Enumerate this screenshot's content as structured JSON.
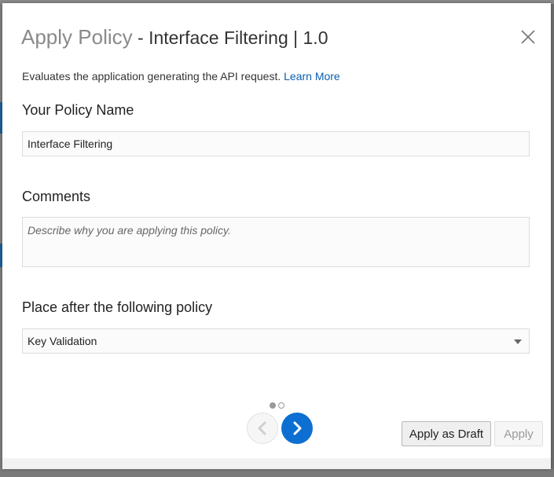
{
  "dialog": {
    "title_main": "Apply Policy",
    "title_sub": " - Interface Filtering | 1.0",
    "description": "Evaluates the application generating the API request.",
    "learn_more": "Learn More"
  },
  "policy_name": {
    "label": "Your Policy Name",
    "value": "Interface Filtering"
  },
  "comments": {
    "label": "Comments",
    "placeholder": "Describe why you are applying this policy."
  },
  "placement": {
    "label": "Place after the following policy",
    "selected": "Key Validation"
  },
  "pagination": {
    "current": 1,
    "total": 2
  },
  "buttons": {
    "apply_as_draft": "Apply as Draft",
    "apply": "Apply"
  },
  "colors": {
    "accent": "#0d6fd1",
    "link": "#0a5fae"
  },
  "icons": {
    "close": "close-icon",
    "prev": "chevron-left-icon",
    "next": "chevron-right-icon",
    "dropdown": "caret-down-icon"
  }
}
